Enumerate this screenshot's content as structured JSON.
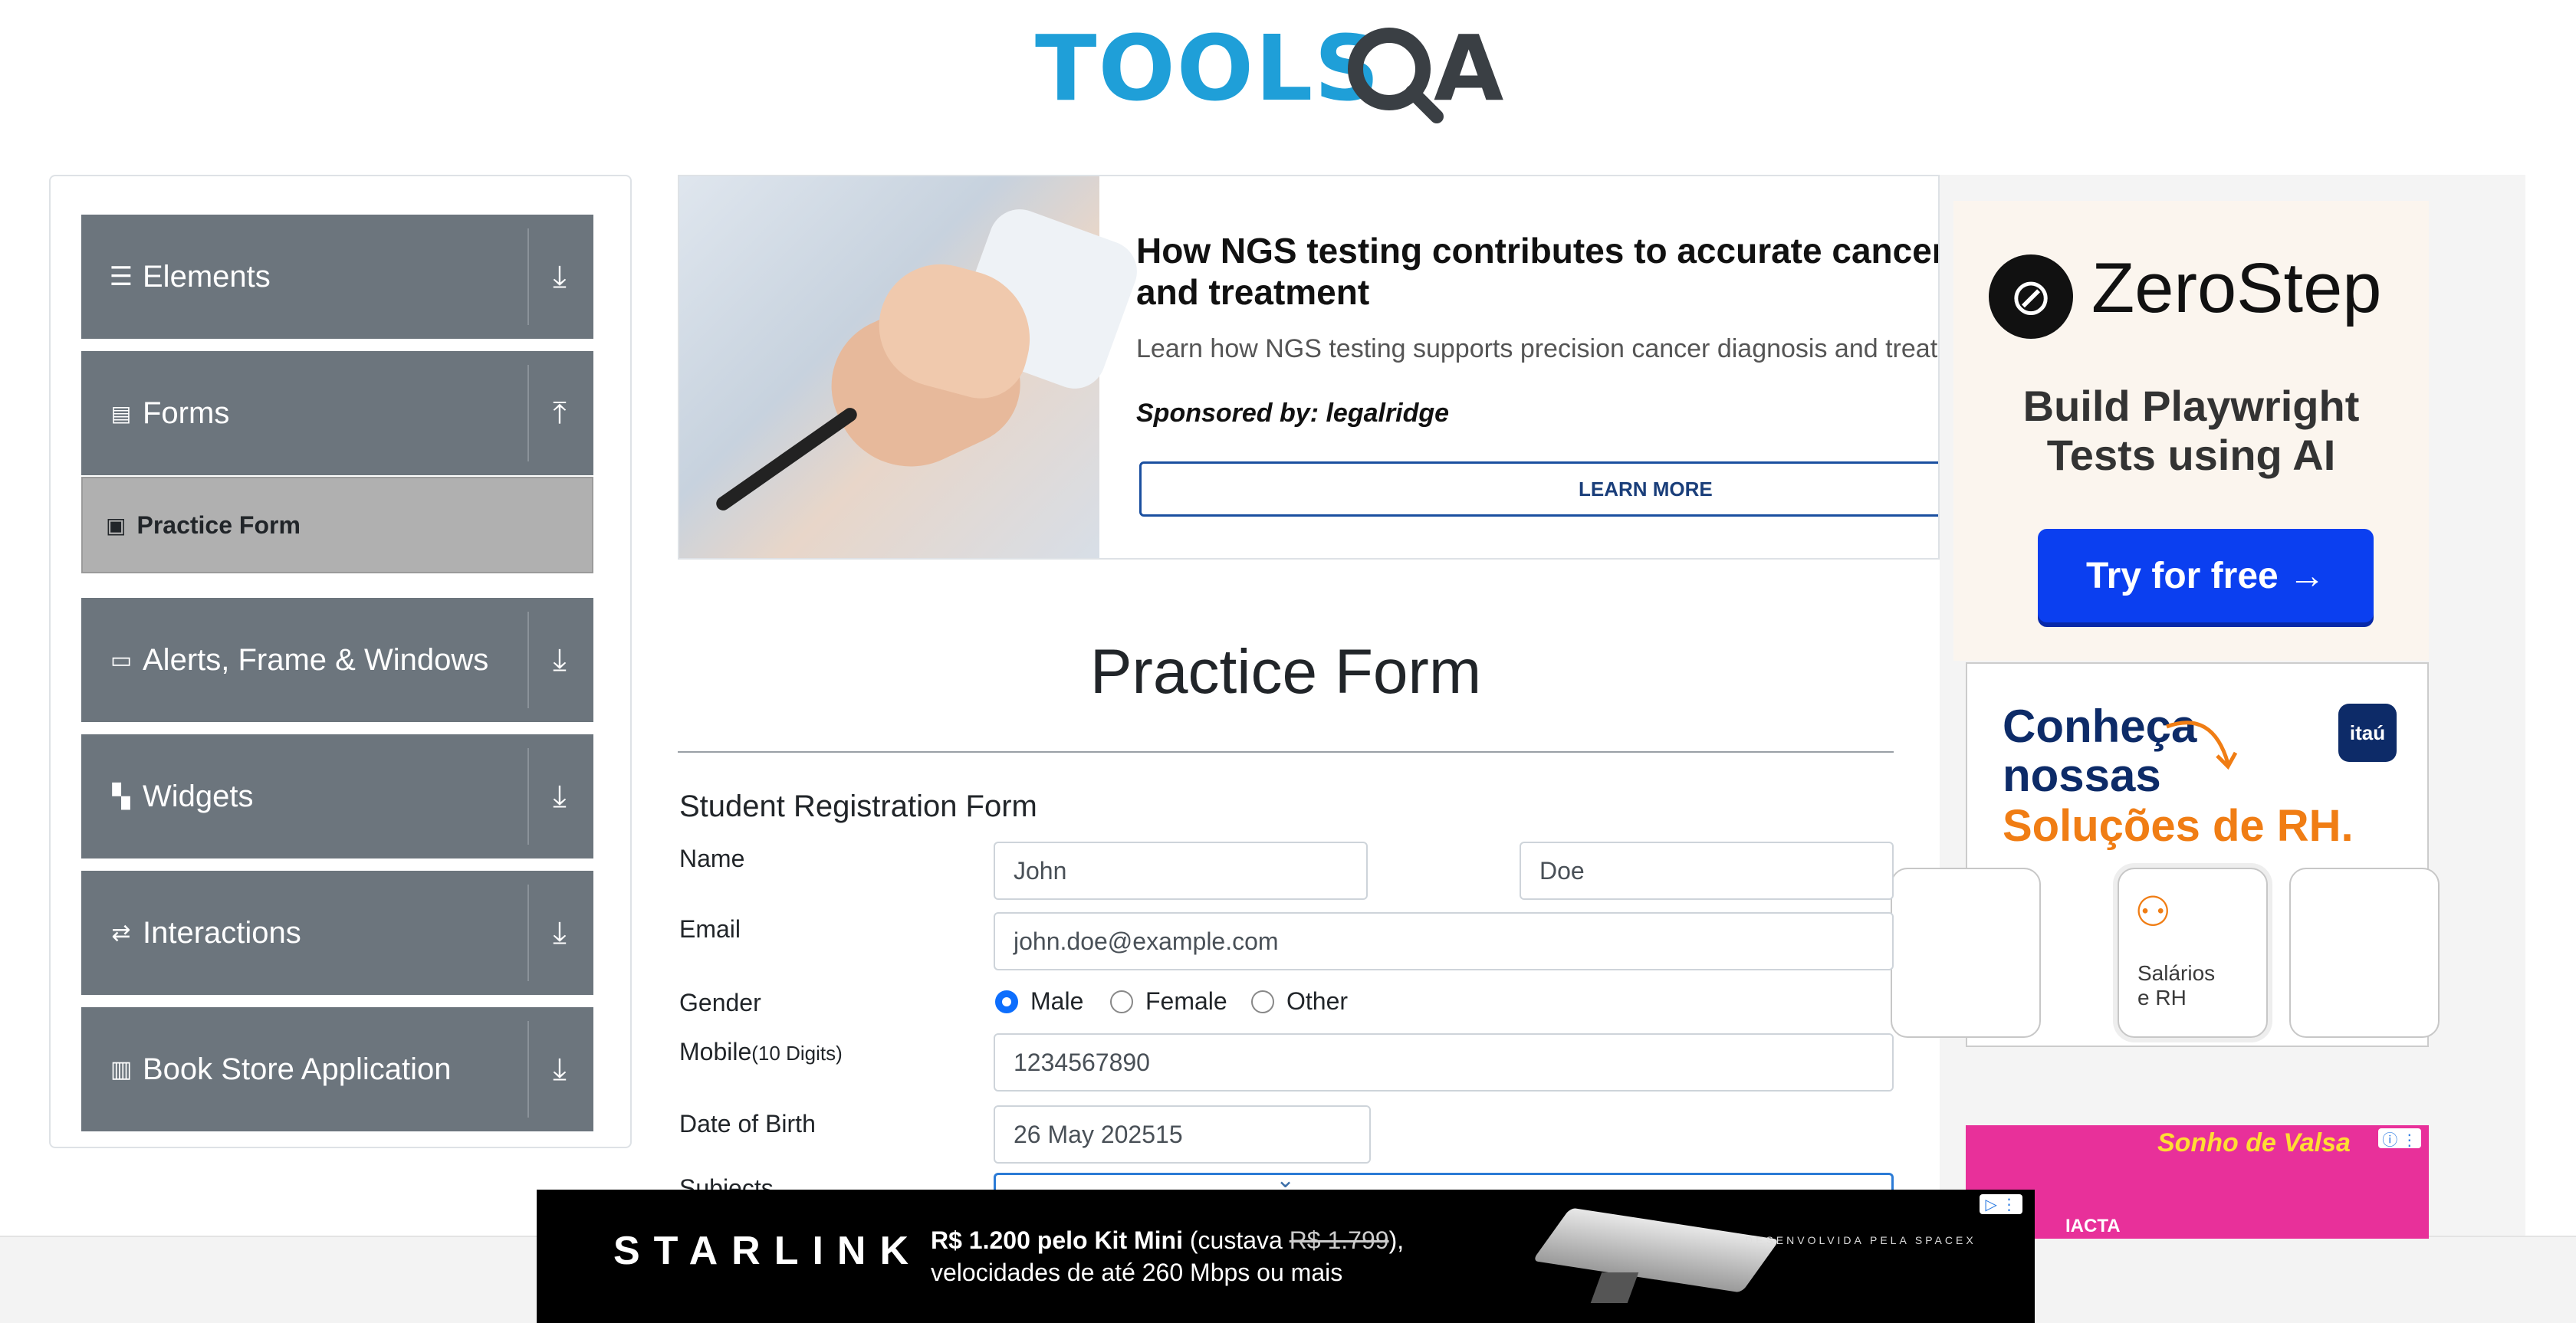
{
  "header": {
    "logo_text": "TOOLSQA"
  },
  "sidebar": {
    "groups": [
      {
        "label": "Elements",
        "icon": "list-icon",
        "arrow": "⤓"
      },
      {
        "label": "Forms",
        "icon": "document-icon",
        "arrow": "⤒"
      },
      {
        "label": "Alerts, Frame & Windows",
        "icon": "window-icon",
        "arrow": "⤓"
      },
      {
        "label": "Widgets",
        "icon": "widgets-icon",
        "arrow": "⤓"
      },
      {
        "label": "Interactions",
        "icon": "interactions-icon",
        "arrow": "⤓"
      },
      {
        "label": "Book Store Application",
        "icon": "books-icon",
        "arrow": "⤓"
      }
    ],
    "active_item": {
      "label": "Practice Form",
      "icon": "form-icon"
    }
  },
  "sponsored_ad": {
    "title": "How NGS testing contributes to accurate cancer d",
    "title_line2": "and treatment",
    "description": "Learn how NGS testing supports precision cancer diagnosis and treatm",
    "sponsor": "Sponsored by: legalridge",
    "button": "LEARN MORE"
  },
  "zerostep_ad": {
    "brand": "ZeroStep",
    "tagline_line1": "Build Playwright",
    "tagline_line2": "Tests using AI",
    "button": "Try for free →"
  },
  "itau_ad": {
    "headline_line1": "Conheça",
    "headline_line2": "nossas",
    "headline_accent": "Soluções de RH.",
    "logo": "itaú",
    "card_line1": "Salários",
    "card_line2": "e RH"
  },
  "pink_ad": {
    "logo": "Sonho de Valsa",
    "text": "IACTA"
  },
  "form": {
    "page_title": "Practice Form",
    "heading": "Student Registration Form",
    "name_label": "Name",
    "first_name": "John",
    "last_name": "Doe",
    "email_label": "Email",
    "email": "john.doe@example.com",
    "gender_label": "Gender",
    "gender_options": [
      "Male",
      "Female",
      "Other"
    ],
    "gender_selected": "Male",
    "mobile_label": "Mobile",
    "mobile_hint": "(10 Digits)",
    "mobile": "1234567890",
    "dob_label": "Date of Birth",
    "dob": "26 May 202515",
    "subjects_label": "Subjects"
  },
  "starlink_ad": {
    "brand": "STARLINK",
    "price_text": "R$ 1.200 pelo Kit Mini",
    "was_text": " (custava ",
    "old_price": "R$ 1.799",
    "close_paren": "),",
    "line2": "velocidades de até 260 Mbps ou mais",
    "developed_by": "DESENVOLVIDA PELA SPACEX"
  },
  "colors": {
    "sidebar_group": "#6c757d",
    "active_item": "#b0b0b0",
    "radio_on": "#0d6efd",
    "zerostep_button": "#0b3ff0",
    "itau_orange": "#f07d14"
  }
}
